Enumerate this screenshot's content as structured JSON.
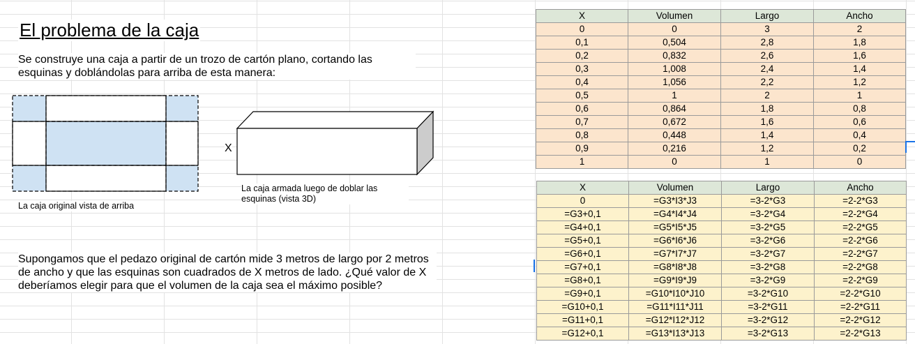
{
  "title": "El problema de la caja",
  "intro": "Se construye una caja a partir de un trozo de cartón plano, cortando las esquinas y doblándolas para arriba de esta manera:",
  "x_label": "X",
  "caption_top_view": "La caja original vista de arriba",
  "caption_3d": "La caja armada luego de doblar las esquinas (vista 3D)",
  "question": "Supongamos que el pedazo original de cartón mide 3 metros de largo por 2 metros de ancho y que las esquinas son cuadrados de X metros de lado. ¿Qué valor de X deberíamos elegir para que el volumen de la caja sea el máximo posible?",
  "colors": {
    "corner_fill": "#cfe2f3",
    "header_fill": "#dde7d8",
    "values_fill": "#fce5cd",
    "formulas_fill": "#fdf2cc",
    "box_side": "#cccccc"
  },
  "values_table": {
    "headers": [
      "X",
      "Volumen",
      "Largo",
      "Ancho"
    ],
    "rows": [
      [
        "0",
        "0",
        "3",
        "2"
      ],
      [
        "0,1",
        "0,504",
        "2,8",
        "1,8"
      ],
      [
        "0,2",
        "0,832",
        "2,6",
        "1,6"
      ],
      [
        "0,3",
        "1,008",
        "2,4",
        "1,4"
      ],
      [
        "0,4",
        "1,056",
        "2,2",
        "1,2"
      ],
      [
        "0,5",
        "1",
        "2",
        "1"
      ],
      [
        "0,6",
        "0,864",
        "1,8",
        "0,8"
      ],
      [
        "0,7",
        "0,672",
        "1,6",
        "0,6"
      ],
      [
        "0,8",
        "0,448",
        "1,4",
        "0,4"
      ],
      [
        "0,9",
        "0,216",
        "1,2",
        "0,2"
      ],
      [
        "1",
        "0",
        "1",
        "0"
      ]
    ]
  },
  "formulas_table": {
    "headers": [
      "X",
      "Volumen",
      "Largo",
      "Ancho"
    ],
    "rows": [
      [
        "0",
        "=G3*I3*J3",
        "=3-2*G3",
        "=2-2*G3"
      ],
      [
        "=G3+0,1",
        "=G4*I4*J4",
        "=3-2*G4",
        "=2-2*G4"
      ],
      [
        "=G4+0,1",
        "=G5*I5*J5",
        "=3-2*G5",
        "=2-2*G5"
      ],
      [
        "=G5+0,1",
        "=G6*I6*J6",
        "=3-2*G6",
        "=2-2*G6"
      ],
      [
        "=G6+0,1",
        "=G7*I7*J7",
        "=3-2*G7",
        "=2-2*G7"
      ],
      [
        "=G7+0,1",
        "=G8*I8*J8",
        "=3-2*G8",
        "=2-2*G8"
      ],
      [
        "=G8+0,1",
        "=G9*I9*J9",
        "=3-2*G9",
        "=2-2*G9"
      ],
      [
        "=G9+0,1",
        "=G10*I10*J10",
        "=3-2*G10",
        "=2-2*G10"
      ],
      [
        "=G10+0,1",
        "=G11*I11*J11",
        "=3-2*G11",
        "=2-2*G11"
      ],
      [
        "=G11+0,1",
        "=G12*I12*J12",
        "=3-2*G12",
        "=2-2*G12"
      ],
      [
        "=G12+0,1",
        "=G13*I13*J13",
        "=3-2*G13",
        "=2-2*G13"
      ]
    ]
  }
}
